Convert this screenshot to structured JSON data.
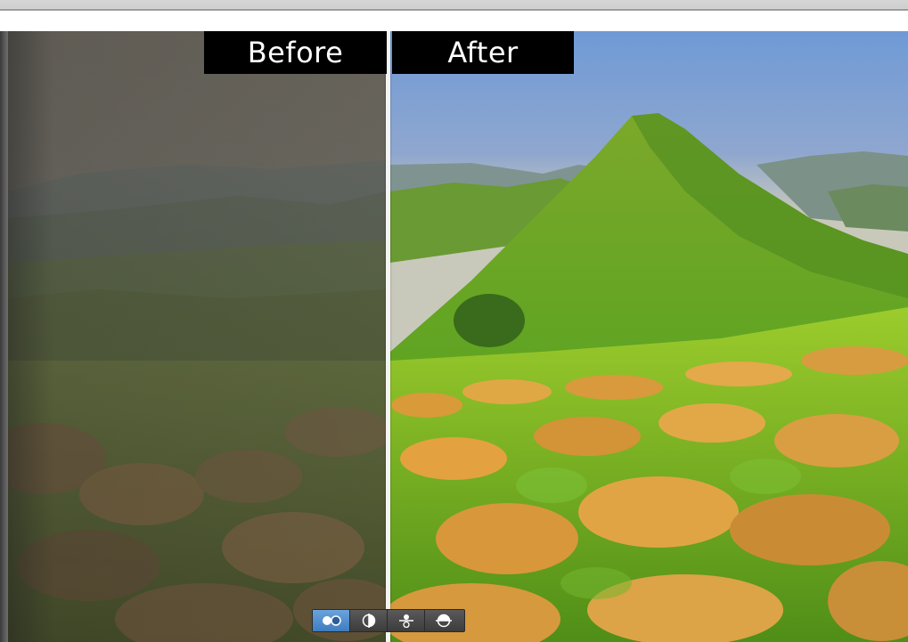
{
  "labels": {
    "before": "Before",
    "after": "After"
  },
  "toolbar": {
    "buttons": [
      {
        "name": "side-by-side-view-icon",
        "active": true
      },
      {
        "name": "split-vertical-view-icon",
        "active": false
      },
      {
        "name": "split-horizontal-view-icon",
        "active": false
      },
      {
        "name": "overlay-view-icon",
        "active": false
      }
    ]
  },
  "colors": {
    "label_background": "#000000",
    "label_text": "#ffffff",
    "active_button": "#4f8fd0",
    "divider": "#f4f4f4"
  }
}
